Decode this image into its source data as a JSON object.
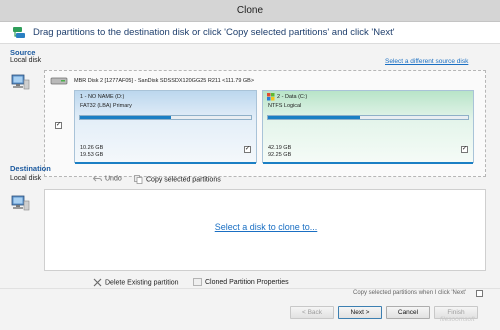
{
  "window": {
    "title": "Clone"
  },
  "header": {
    "text": "Drag partitions to the destination disk or click 'Copy selected partitions' and click 'Next'"
  },
  "source": {
    "section_title": "Source",
    "subtitle": "Local disk",
    "select_link": "Select a different source disk",
    "disk_desc": "MBR Disk 2 [1277AF05] - SanDisk SDSSDX120GG25 R211  <111.79 GB>",
    "partitions": [
      {
        "name": "1 - NO NAME (D:)",
        "fs": "FAT32 (LBA) Primary",
        "used": "10.26 GB",
        "total": "19.53 GB",
        "fill_fraction": 0.53,
        "checked": true,
        "checkmark": "✓"
      },
      {
        "name": "2 - Data (C:)",
        "fs": "NTFS Logical",
        "used": "42.19 GB",
        "total": "92.25 GB",
        "fill_fraction": 0.46,
        "checked": true,
        "checkmark": "✓"
      }
    ],
    "disk_checkbox_mark": "✓"
  },
  "destination": {
    "section_title": "Destination",
    "subtitle": "Local disk",
    "undo_label": "Undo",
    "copy_label": "Copy selected partitions",
    "select_link": "Select a disk to clone to...",
    "delete_label": "Delete Existing partition",
    "props_label": "Cloned Partition Properties"
  },
  "footer": {
    "notice": "Copy selected partitions when I click 'Next'",
    "back": "< Back",
    "next": "Next >",
    "cancel": "Cancel",
    "finish": "Finish"
  },
  "watermark": "filesoomsoft"
}
